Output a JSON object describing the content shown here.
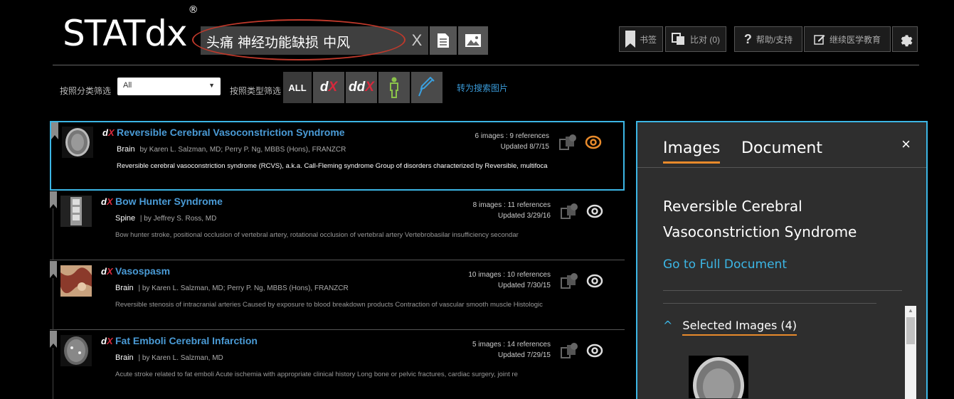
{
  "header": {
    "logo": "STATdx",
    "logo_mark": "®",
    "search_value": "头痛 神经功能缺损 中风",
    "search_clear": "X",
    "bookmarks_label": "书签",
    "compare_label": "比对 (0)",
    "help_label": "帮助/支持",
    "cme_label": "继续医学教育"
  },
  "filters": {
    "category_label": "按照分类筛选",
    "category_value": "All",
    "type_label": "按照类型筛选",
    "type_all": "ALL",
    "type_dx": "dX",
    "type_ddx": "ddX",
    "switch_link": "转为搜索图片"
  },
  "results": [
    {
      "title": "Reversible Cerebral Vasoconstriction Syndrome",
      "subject": "Brain",
      "authors": "by Karen L. Salzman, MD; Perry P. Ng, MBBS (Hons), FRANZCR",
      "snippet": "Reversible cerebral vasoconstriction syndrome (RCVS), a.k.a. Call-Fleming syndrome Group of disorders characterized by Reversible, multifoca",
      "counts": "6 images : 9 references",
      "updated": "Updated 8/7/15"
    },
    {
      "title": "Bow Hunter Syndrome",
      "subject": "Spine",
      "authors": "| by Jeffrey S. Ross, MD",
      "snippet": "Bow hunter stroke, positional occlusion of vertebral artery, rotational occlusion of vertebral artery Vertebrobasilar insufficiency secondar",
      "counts": "8 images : 11 references",
      "updated": "Updated 3/29/16"
    },
    {
      "title": "Vasospasm",
      "subject": "Brain",
      "authors": "| by Karen L. Salzman, MD; Perry P. Ng, MBBS (Hons), FRANZCR",
      "snippet": "Reversible stenosis of intracranial arteries Caused by exposure to blood breakdown products Contraction of vascular smooth muscle Histologic",
      "counts": "10 images : 10 references",
      "updated": "Updated 7/30/15"
    },
    {
      "title": "Fat Emboli Cerebral Infarction",
      "subject": "Brain",
      "authors": "| by Karen L. Salzman, MD",
      "snippet": "Acute stroke related to fat emboli Acute ischemia with appropriate clinical history Long bone or pelvic fractures, cardiac surgery, joint re",
      "counts": "5 images : 14 references",
      "updated": "Updated 7/29/15"
    }
  ],
  "panel": {
    "tab_images": "Images",
    "tab_document": "Document",
    "close": "×",
    "title": "Reversible Cerebral Vasoconstriction Syndrome",
    "full_doc_link": "Go to Full Document",
    "selected_images": "Selected Images (4)"
  },
  "colors": {
    "accent_blue": "#3cb6e5",
    "link_blue": "#4a9bd6",
    "orange": "#e88a2b",
    "red": "#d7283c"
  }
}
